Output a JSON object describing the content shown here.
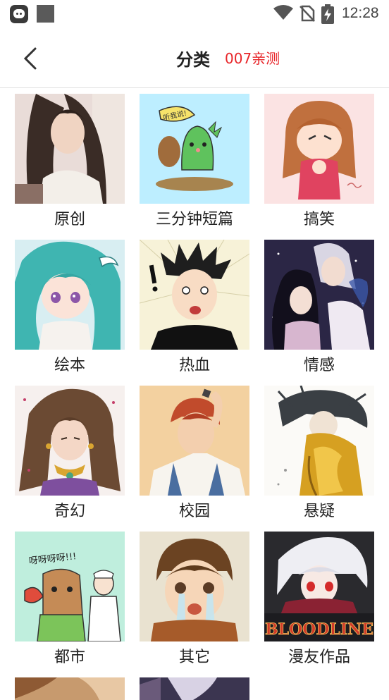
{
  "status_bar": {
    "time": "12:28"
  },
  "header": {
    "title": "分类",
    "subtitle": "007亲测"
  },
  "categories": [
    {
      "label": "原创"
    },
    {
      "label": "三分钟短篇"
    },
    {
      "label": "搞笑"
    },
    {
      "label": "绘本"
    },
    {
      "label": "热血"
    },
    {
      "label": "情感"
    },
    {
      "label": "奇幻"
    },
    {
      "label": "校园"
    },
    {
      "label": "悬疑"
    },
    {
      "label": "都市"
    },
    {
      "label": "其它"
    },
    {
      "label": "漫友作品"
    }
  ],
  "thumbnail_texts": {
    "dino_bubble": "听我说!",
    "city_bubble": "呀呀呀呀!!!",
    "logo": "BLOODLINE"
  },
  "colors": {
    "accent": "#e8262a",
    "text": "#222222",
    "divider": "#e2e2e2"
  }
}
